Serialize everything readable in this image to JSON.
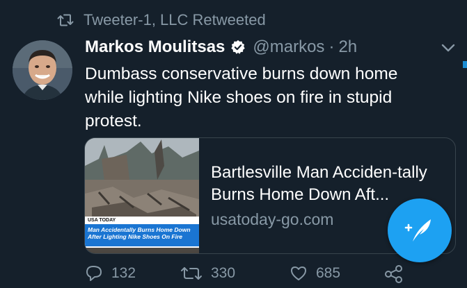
{
  "retweet_header": {
    "text": "Tweeter-1, LLC Retweeted",
    "icon": "retweet-icon"
  },
  "tweet": {
    "author_name": "Markos Moulitsas",
    "verified": true,
    "handle": "@markos",
    "separator": "·",
    "time": "2h",
    "text": "Dumbass conservative burns down home while lighting Nike shoes on fire in stupid protest."
  },
  "card": {
    "title": "Bartlesville Man Acciden-tally Burns Home Down Aft...",
    "domain": "usatoday-go.com",
    "image_brand": "USA TODAY",
    "image_headline": "Man Accidentally Burns Home Down After Lighting Nike Shoes On Fire"
  },
  "actions": {
    "reply_count": "132",
    "retweet_count": "330",
    "like_count": "685"
  },
  "colors": {
    "background": "#15202b",
    "muted": "#8899a6",
    "accent": "#1da1f2",
    "border": "#38444d"
  }
}
